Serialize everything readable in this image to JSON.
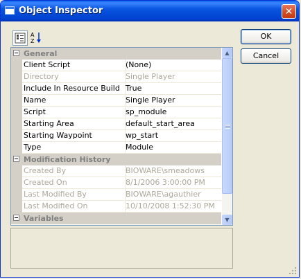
{
  "window": {
    "title": "Object Inspector",
    "close_glyph": "✕"
  },
  "toolbar": {
    "categorized_icon": "categorized-view-icon",
    "alphabetical_icon": "alphabetical-sort-icon"
  },
  "buttons": {
    "ok": "OK",
    "cancel": "Cancel"
  },
  "categories": [
    {
      "label": "General",
      "rows": [
        {
          "name": "Client Script",
          "value": "(None)",
          "disabled": false
        },
        {
          "name": "Directory",
          "value": "Single Player",
          "disabled": true
        },
        {
          "name": "Include In Resource Build",
          "value": "True",
          "disabled": false
        },
        {
          "name": "Name",
          "value": "Single Player",
          "disabled": false
        },
        {
          "name": "Script",
          "value": "sp_module",
          "disabled": false
        },
        {
          "name": "Starting Area",
          "value": "default_start_area",
          "disabled": false
        },
        {
          "name": "Starting Waypoint",
          "value": "wp_start",
          "disabled": false
        },
        {
          "name": "Type",
          "value": "Module",
          "disabled": false
        }
      ]
    },
    {
      "label": "Modification History",
      "rows": [
        {
          "name": "Created By",
          "value": "BIOWARE\\smeadows",
          "disabled": true
        },
        {
          "name": "Created On",
          "value": "8/1/2006 3:00:00 PM",
          "disabled": true
        },
        {
          "name": "Last Modified By",
          "value": "BIOWARE\\agauthier",
          "disabled": true
        },
        {
          "name": "Last Modified On",
          "value": "10/10/2008 1:52:30 PM",
          "disabled": true
        }
      ]
    },
    {
      "label": "Variables",
      "rows": []
    }
  ],
  "scrollbar": {
    "up_glyph": "▲",
    "down_glyph": "▼"
  }
}
